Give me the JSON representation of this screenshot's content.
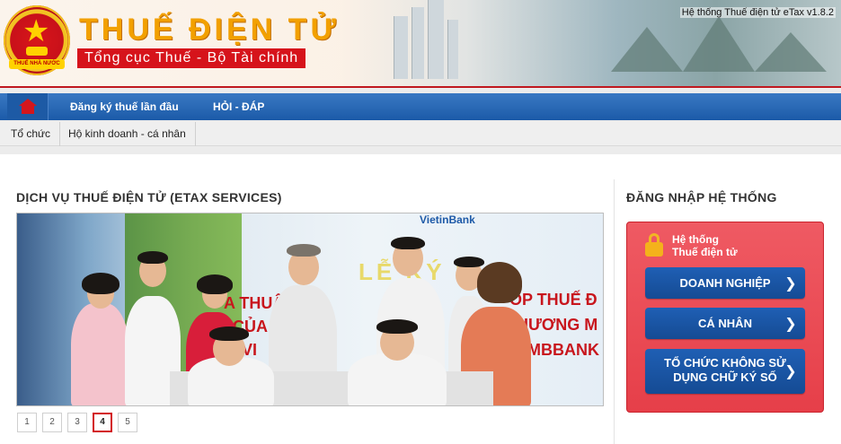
{
  "header": {
    "brand_title": "THUẾ ĐIỆN TỬ",
    "brand_subtitle": "Tổng cục Thuế - Bộ Tài chính",
    "emblem_banner": "THUẾ NHÀ NƯỚC",
    "version": "Hệ thống Thuế điện tử eTax v1.8.2",
    "colors": {
      "title": "#f2a000",
      "subtitle_bg": "#d6131b",
      "rule": "#c0181f"
    }
  },
  "nav": {
    "home_icon": "home-icon",
    "items": [
      {
        "label": "Đăng ký thuế lần đầu"
      },
      {
        "label": "HỎI - ĐÁP"
      }
    ],
    "colors": {
      "bar": "#1b5aa8"
    }
  },
  "subnav": {
    "items": [
      {
        "label": "Tổ chức"
      },
      {
        "label": "Hộ kinh doanh - cá nhân"
      }
    ]
  },
  "services": {
    "title": "DỊCH VỤ THUẾ ĐIỆN TỬ (ETAX SERVICES)",
    "slide": {
      "bank_text": "VietinBank",
      "big_text": "LỄ KÝ K",
      "red_lines": [
        "A THUẬ",
        "ỐP THUẾ Đ",
        "CỦA T",
        "HƯƠNG M",
        "VI",
        "MBBANK"
      ]
    },
    "pager": {
      "pages": [
        "1",
        "2",
        "3",
        "4",
        "5"
      ],
      "active": "4"
    }
  },
  "login": {
    "title": "ĐĂNG NHẬP HỆ THỐNG",
    "panel_title_line1": "Hệ thống",
    "panel_title_line2": "Thuế điện tử",
    "lock_icon": "lock-icon",
    "buttons": [
      {
        "label": "DOANH NGHIỆP"
      },
      {
        "label": "CÁ NHÂN"
      },
      {
        "label_line1": "TỔ CHỨC KHÔNG SỬ",
        "label_line2": "DỤNG CHỮ KÝ SỐ"
      }
    ],
    "colors": {
      "panel": "#e63f49",
      "button": "#154b94"
    }
  }
}
